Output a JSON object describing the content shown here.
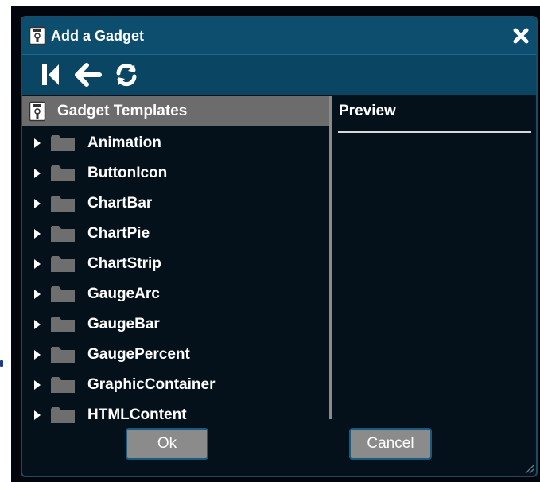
{
  "dialog": {
    "title": "Add a Gadget",
    "title_icon": "gadget-icon",
    "close_icon": "close-icon"
  },
  "toolbar": {
    "buttons": [
      {
        "name": "first-page-button",
        "icon": "skip-back-icon"
      },
      {
        "name": "back-button",
        "icon": "arrow-left-icon"
      },
      {
        "name": "refresh-button",
        "icon": "refresh-icon"
      }
    ]
  },
  "tree": {
    "header": "Gadget Templates",
    "header_icon": "gadget-icon",
    "items": [
      {
        "label": "Animation"
      },
      {
        "label": "ButtonIcon"
      },
      {
        "label": "ChartBar"
      },
      {
        "label": "ChartPie"
      },
      {
        "label": "ChartStrip"
      },
      {
        "label": "GaugeArc"
      },
      {
        "label": "GaugeBar"
      },
      {
        "label": "GaugePercent"
      },
      {
        "label": "GraphicContainer"
      },
      {
        "label": "HTMLContent"
      }
    ]
  },
  "preview": {
    "title": "Preview"
  },
  "buttons": {
    "ok": "Ok",
    "cancel": "Cancel"
  },
  "colors": {
    "titlebar": "#0d4d6e",
    "toolbar": "#0a4563",
    "background": "#04101a",
    "tree_header": "#6c6c6c",
    "button": "#8b8b8b",
    "button_border": "#1a5a80"
  }
}
